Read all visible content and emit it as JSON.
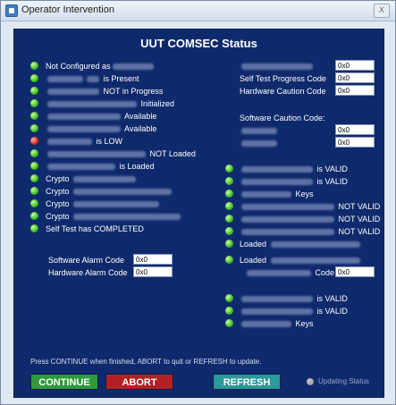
{
  "window": {
    "title": "Operator Intervention",
    "close_label": "X"
  },
  "panel": {
    "title": "UUT COMSEC Status"
  },
  "left_status": [
    {
      "prefix": "Not Configured as",
      "suffix": "",
      "state": "green"
    },
    {
      "prefix": "",
      "suffix": "is Present",
      "state": "green"
    },
    {
      "prefix": "",
      "suffix": "NOT in Progress",
      "state": "green"
    },
    {
      "prefix": "",
      "suffix": "Initialized",
      "state": "green"
    },
    {
      "prefix": "",
      "suffix": "Available",
      "state": "green"
    },
    {
      "prefix": "",
      "suffix": "Available",
      "state": "green"
    },
    {
      "prefix": "",
      "suffix": "is LOW",
      "state": "red"
    },
    {
      "prefix": "",
      "suffix": "NOT Loaded",
      "state": "green"
    },
    {
      "prefix": "",
      "suffix": "is Loaded",
      "state": "green"
    },
    {
      "prefix": "Crypto",
      "suffix": "",
      "state": "green"
    },
    {
      "prefix": "Crypto",
      "suffix": "",
      "state": "green"
    },
    {
      "prefix": "Crypto",
      "suffix": "",
      "state": "green"
    },
    {
      "prefix": "Crypto",
      "suffix": "",
      "state": "green"
    },
    {
      "prefix": "Self Test has COMPLETED",
      "suffix": "",
      "state": "green"
    }
  ],
  "alarms": {
    "software_label": "Software Alarm Code",
    "software_value": "0x0",
    "hardware_label": "Hardware Alarm Code",
    "hardware_value": "0x0"
  },
  "right_codes": {
    "code1_value": "0x0",
    "self_test_label": "Self Test Progress Code",
    "self_test_value": "0x0",
    "hw_caution_label": "Hardware Caution Code",
    "hw_caution_value": "0x0",
    "sw_caution_label": "Software Caution Code:",
    "lower_value": "0x0",
    "upper_value": "0x0"
  },
  "right_status": [
    {
      "suffix": "is VALID"
    },
    {
      "suffix": "is VALID"
    },
    {
      "suffix": "Keys"
    },
    {
      "suffix": "NOT VALID"
    },
    {
      "suffix": "NOT VALID"
    },
    {
      "suffix": "NOT VALID"
    },
    {
      "prefix": "Loaded",
      "suffix": ""
    },
    {
      "prefix": "Loaded",
      "suffix": ""
    },
    {
      "code_label": "Code",
      "code_value": "0x0"
    },
    {
      "suffix": "is VALID"
    },
    {
      "suffix": "is VALID"
    },
    {
      "suffix": "Keys"
    }
  ],
  "instructions": "Press CONTINUE when finished, ABORT to quit or REFRESH to update.",
  "buttons": {
    "continue": "CONTINUE",
    "abort": "ABORT",
    "refresh": "REFRESH"
  },
  "updating_status": "Updating Status"
}
